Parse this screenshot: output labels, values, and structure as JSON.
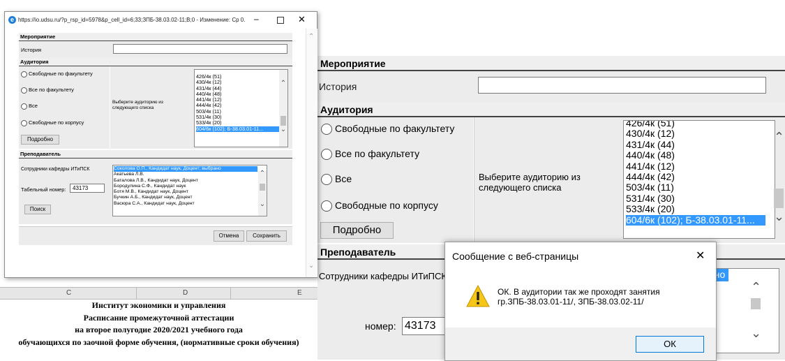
{
  "popup": {
    "title": "https://io.udsu.ru/?p_rsp_id=5978&p_cell_id=6;33;ЗПБ-38.03.02-11;В;0 - Изменение: Ср 0...",
    "event_header": "Мероприятие",
    "event_label": "История",
    "event_value": "",
    "aud_header": "Аудитория",
    "radios": [
      "Свободные по факультету",
      "Все по факультету",
      "Все",
      "Свободные по корпусу"
    ],
    "details_button": "Подробно",
    "choose_text": "Выберите аудиторию из следующего списка",
    "rooms": [
      "426/4к (51)",
      "430/4к (12)",
      "431/4к (44)",
      "440/4к (48)",
      "441/4к (12)",
      "444/4к (42)",
      "503/4к (11)",
      "531/4к (30)",
      "533/4к (20)",
      "604/6к (102); Б-38.03.01-11..."
    ],
    "teacher_header": "Преподаватель",
    "staff_label": "Сотрудники кафедры ИТиПСК",
    "tabnum_label": "Табельный номер:",
    "tabnum_value": "43173",
    "search_button": "Поиск",
    "teachers": [
      "Соколова О.П., Кандидат наук, Доцент; выбрано",
      "Акатьева Л.В.",
      "Баталова Л.В., Кандидат наук, Доцент",
      "Бородулина С.Ф., Кандидат наук",
      "Ботя М.В., Кандидат наук, Доцент",
      "Бучкин А.Б., Кандидат наук, Доцент",
      "Васюра С.А., Кандидат наук, Доцент"
    ],
    "cancel_button": "Отмена",
    "save_button": "Сохранить"
  },
  "zoom": {
    "event_header": "Мероприятие",
    "event_label": "История",
    "aud_header": "Аудитория",
    "radios": [
      "Свободные по факультету",
      "Все по факультету",
      "Все",
      "Свободные по корпусу"
    ],
    "details_button": "Подробно",
    "choose_text": "Выберите аудиторию из следующего списка",
    "rooms": [
      "426/4к (51)",
      "430/4к (12)",
      "431/4к (44)",
      "440/4к (48)",
      "441/4к (12)",
      "444/4к (42)",
      "503/4к (11)",
      "531/4к (30)",
      "533/4к (20)",
      "604/6к (102); Б-38.03.01-11..."
    ],
    "teacher_header": "Преподаватель",
    "staff_label": "Сотрудники кафедры ИТиПСК",
    "staff_selected_fragment": "ано",
    "tabnum_label": "номер:",
    "tabnum_value": "43173"
  },
  "sheet": {
    "columns": [
      "C",
      "D",
      "E"
    ],
    "lines": [
      "Институт экономики и управления",
      "Расписание промежуточной аттестации",
      "на второе полугодие 2020/2021 учебного года",
      "обучающихся по заочной форме обучения, (нормативные сроки обучения)"
    ]
  },
  "msgbox": {
    "title": "Сообщение с веб-страницы",
    "text": "ОК. В аудитории так же проходят занятия гр.ЗПБ-38.03.01-11/, ЗПБ-38.03.02-11/",
    "ok_button": "ОК"
  },
  "colors": {
    "selection": "#3399ff",
    "warning": "#f5c518"
  }
}
